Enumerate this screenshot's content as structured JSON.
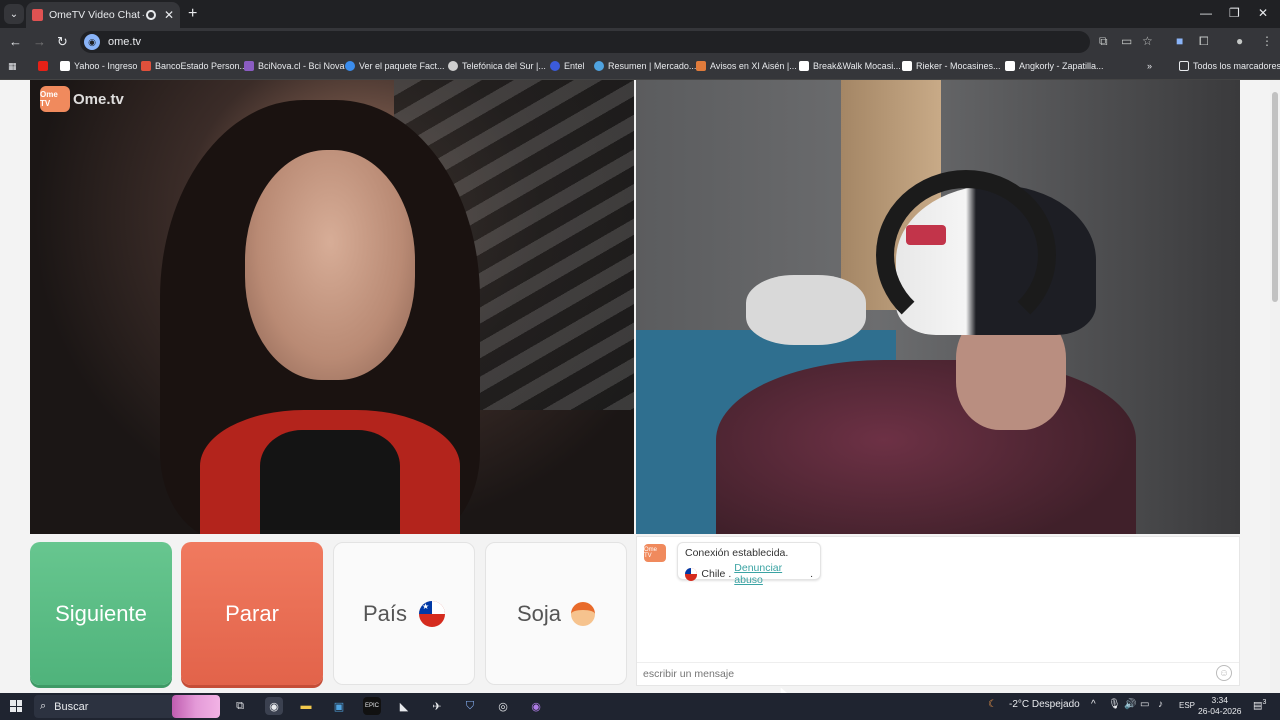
{
  "browser": {
    "tab_title": "OmeTV Video Chat — Alte",
    "url": "ome.tv",
    "bookmarks": [
      {
        "label": "Yahoo - Ingreso",
        "color": "#ffffff"
      },
      {
        "label": "BancoEstado Person...",
        "color": "#e0503b"
      },
      {
        "label": "BciNova.cl - Bci Nova",
        "color": "#8a5cc2"
      },
      {
        "label": "Ver el paquete Fact...",
        "color": "#3b8ded"
      },
      {
        "label": "Telefónica del Sur |...",
        "color": "#cfcfcf"
      },
      {
        "label": "Entel",
        "color": "#3b5bdb"
      },
      {
        "label": "Resumen | Mercado...",
        "color": "#4fa3e0"
      },
      {
        "label": "Avisos en XI Aisén |...",
        "color": "#e07b3b"
      },
      {
        "label": "Break&Walk Mocasi...",
        "color": "#ffffff"
      },
      {
        "label": "Rieker - Mocasines...",
        "color": "#ffffff"
      },
      {
        "label": "Angkorly - Zapatilla...",
        "color": "#ffffff"
      }
    ],
    "all_bookmarks": "Todos los marcadores"
  },
  "app": {
    "logo_text": "Ome.tv",
    "logo_badge": "Ome TV",
    "buttons": {
      "next": "Siguiente",
      "stop": "Parar",
      "country": "País",
      "gender": "Soja"
    },
    "chat": {
      "status": "Conexión establecida.",
      "country": "Chile",
      "separator": ".",
      "report_link": "Denunciar abuso",
      "report_suffix": ".",
      "input_placeholder": "escribir un mensaje"
    }
  },
  "taskbar": {
    "search_label": "Buscar",
    "weather": "-2°C  Despejado",
    "language": "ESP",
    "time": "3:34",
    "date": "26-04-2026",
    "notifications": "3"
  },
  "colors": {
    "next_button": "#5bbd85",
    "stop_button": "#e96e55",
    "link": "#3aa3a3"
  }
}
